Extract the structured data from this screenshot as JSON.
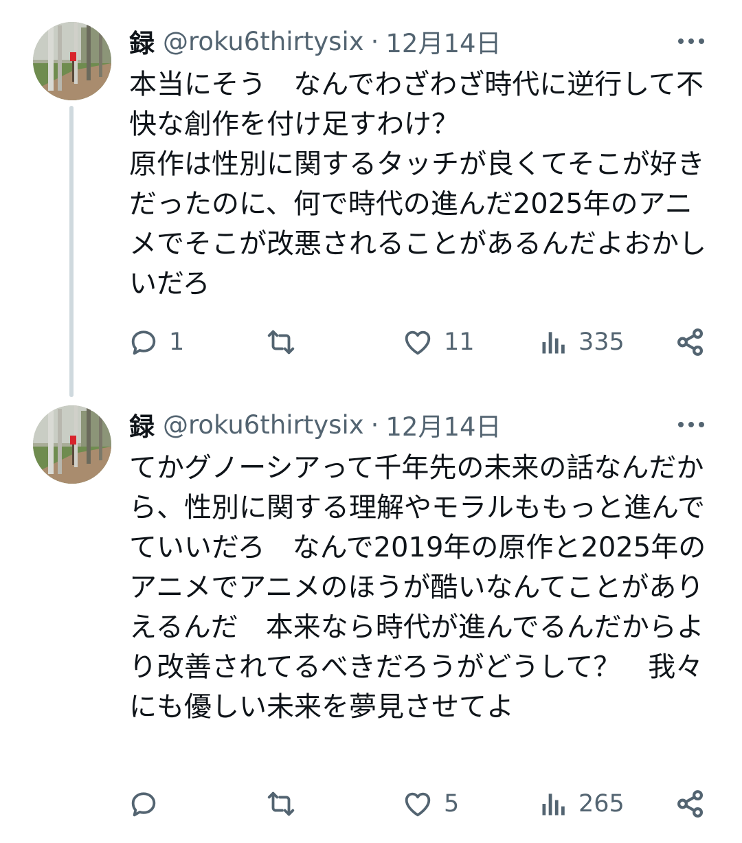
{
  "tweets": [
    {
      "name": "録",
      "handle": "@roku6thirtysix",
      "separator": "·",
      "date": "12月14日",
      "text": "本当にそう　なんでわざわざ時代に逆行して不快な創作を付け足すわけ？\n原作は性別に関するタッチが良くてそこが好きだったのに、何で時代の進んだ2025年のアニメでそこが改悪されることがあるんだよおかしいだろ",
      "reply_count": "1",
      "retweet_count": "",
      "like_count": "11",
      "view_count": "335",
      "icons": {
        "reply": "reply-icon",
        "retweet": "retweet-icon",
        "like": "heart-icon",
        "views": "views-icon",
        "share": "share-icon",
        "more": "more-icon"
      }
    },
    {
      "name": "録",
      "handle": "@roku6thirtysix",
      "separator": "·",
      "date": "12月14日",
      "text": "てかグノーシアって千年先の未来の話なんだから、性別に関する理解やモラルももっと進んでていいだろ　なんで2019年の原作と2025年のアニメでアニメのほうが酷いなんてことがありえるんだ　本来なら時代が進んでるんだからより改善されてるべきだろうがどうして？　我々にも優しい未来を夢見させてよ",
      "reply_count": "",
      "retweet_count": "",
      "like_count": "5",
      "view_count": "265",
      "icons": {
        "reply": "reply-icon",
        "retweet": "retweet-icon",
        "like": "heart-icon",
        "views": "views-icon",
        "share": "share-icon",
        "more": "more-icon"
      }
    }
  ],
  "colors": {
    "text": "#0f1419",
    "secondary": "#536471",
    "thread_line": "#cfd9de"
  }
}
